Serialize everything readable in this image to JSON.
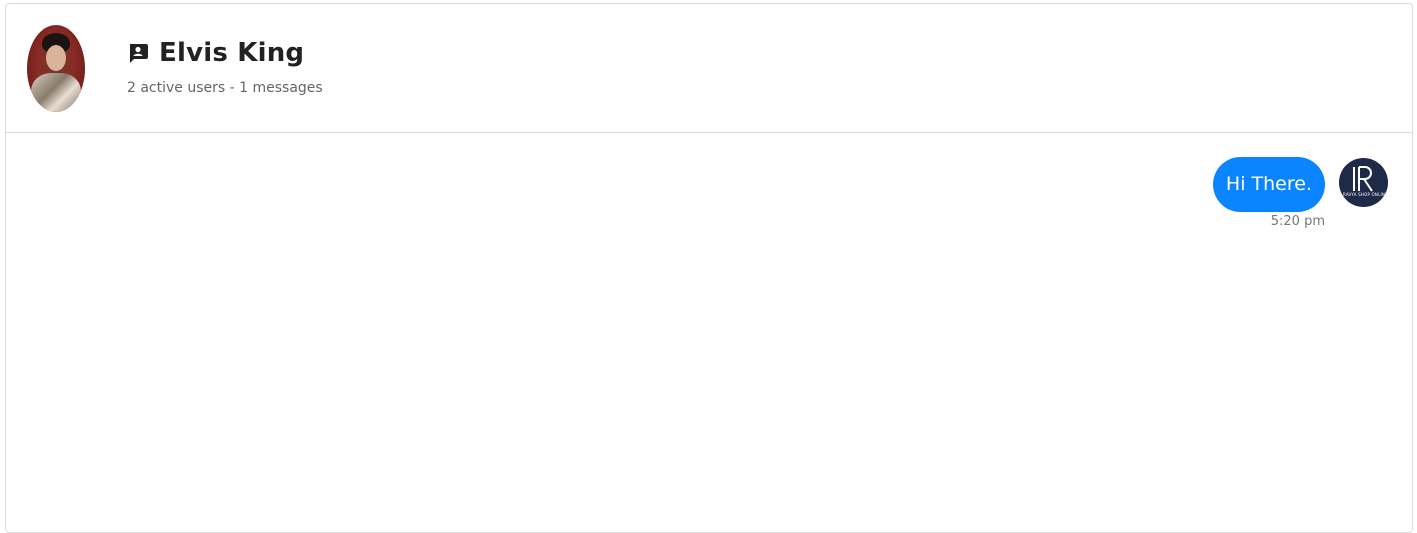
{
  "header": {
    "contact_name": "Elvis King",
    "meta": "2 active users - 1 messages",
    "icon": "chat-bubble-person-icon",
    "avatar": "contact-photo"
  },
  "messages": [
    {
      "text": "Hi There.",
      "time": "5:20 pm",
      "sender_avatar": "brand-logo-avatar",
      "logo_caption": "RAVYA SHOP ONLINE"
    }
  ],
  "colors": {
    "bubble": "#0a84ff",
    "bubble_text": "#ffffff",
    "sender_avatar_bg": "#1f2a48",
    "border": "#dcdcdc"
  }
}
